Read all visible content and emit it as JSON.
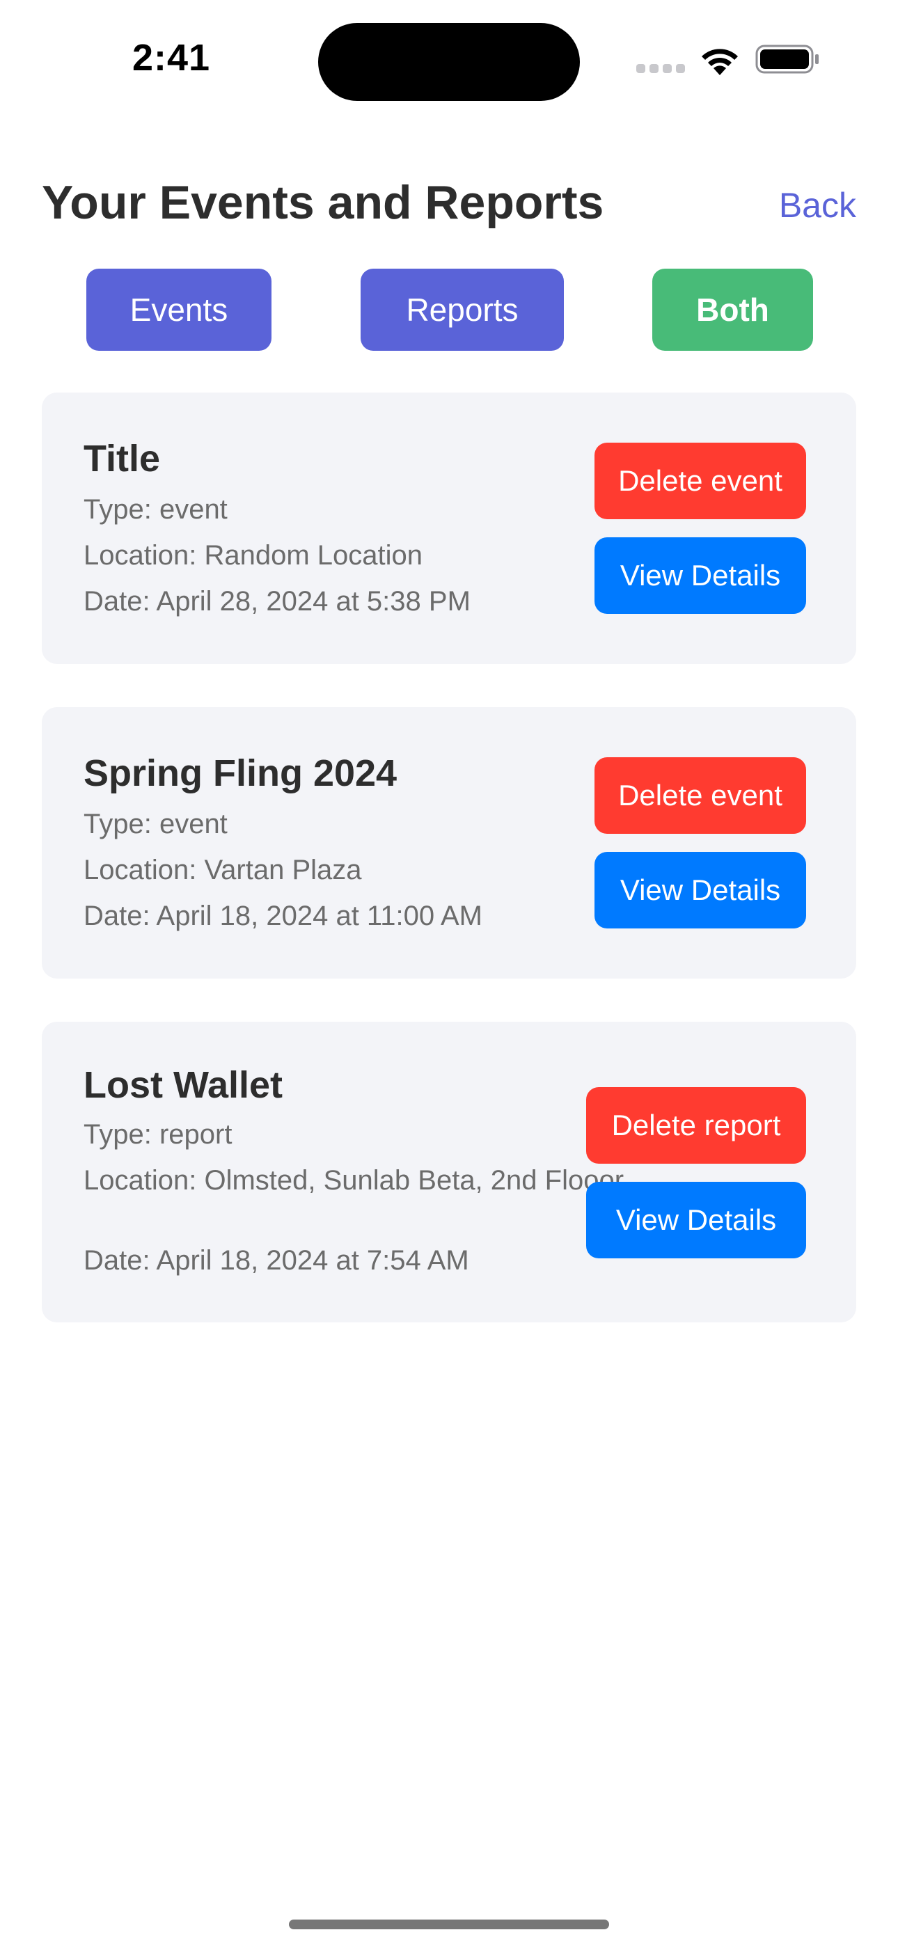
{
  "status_bar": {
    "time": "2:41"
  },
  "header": {
    "title": "Your Events and Reports",
    "back_label": "Back"
  },
  "filters": {
    "events": "Events",
    "reports": "Reports",
    "both": "Both"
  },
  "items": [
    {
      "title": "Title",
      "type": "Type: event",
      "location": "Location: Random Location",
      "date": "Date: April 28, 2024 at 5:38 PM",
      "delete_label": "Delete event",
      "view_label": "View Details"
    },
    {
      "title": "Spring Fling 2024",
      "type": "Type: event",
      "location": "Location: Vartan Plaza",
      "date": "Date: April 18, 2024 at 11:00 AM",
      "delete_label": "Delete event",
      "view_label": "View Details"
    },
    {
      "title": "Lost Wallet",
      "type": "Type: report",
      "location": "Location: Olmsted, Sunlab Beta, 2nd Flooor",
      "date": "Date: April 18, 2024 at 7:54 AM",
      "delete_label": "Delete report",
      "view_label": "View Details"
    }
  ],
  "colors": {
    "primary": "#5a63d8",
    "active_filter": "#48bb78",
    "delete": "#ff3b30",
    "view": "#007aff",
    "card_bg": "#f3f4f8"
  },
  "icons": [
    "cellular-signal-icon",
    "wifi-icon",
    "battery-icon"
  ]
}
